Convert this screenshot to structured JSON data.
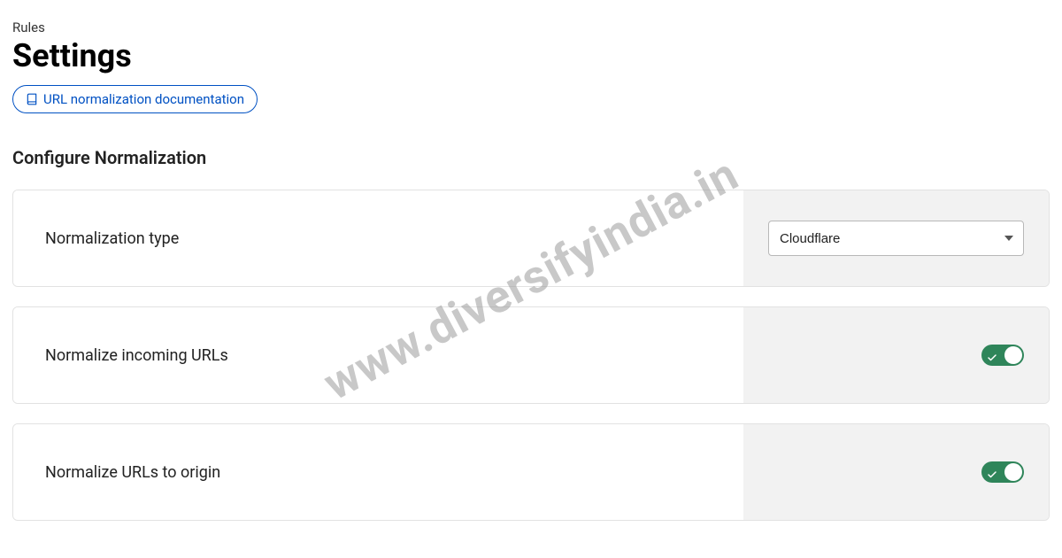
{
  "breadcrumb": "Rules",
  "title": "Settings",
  "doc_link_label": "URL normalization documentation",
  "section_heading": "Configure Normalization",
  "rows": {
    "type": {
      "label": "Normalization type",
      "selected": "Cloudflare"
    },
    "incoming": {
      "label": "Normalize incoming URLs",
      "enabled": true
    },
    "origin": {
      "label": "Normalize URLs to origin",
      "enabled": true
    }
  },
  "watermark": "www.diversifyindia.in"
}
